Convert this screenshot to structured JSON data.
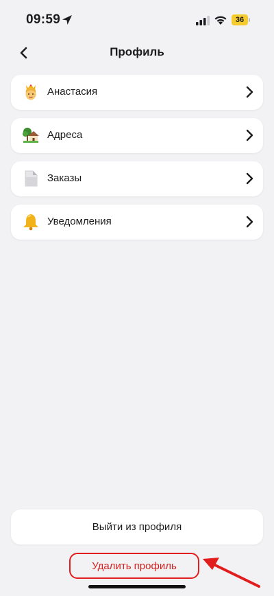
{
  "status_bar": {
    "time": "09:59",
    "battery_level": "36",
    "battery_color": "#f5cc2e"
  },
  "nav": {
    "title": "Профиль",
    "back_icon": "chevron-left-icon"
  },
  "menu": {
    "items": [
      {
        "label": "Анастасия",
        "icon": "princess-emoji-icon"
      },
      {
        "label": "Адреса",
        "icon": "house-with-garden-icon"
      },
      {
        "label": "Заказы",
        "icon": "document-icon"
      },
      {
        "label": "Уведомления",
        "icon": "bell-icon"
      }
    ]
  },
  "actions": {
    "logout_label": "Выйти из профиля",
    "delete_label": "Удалить профиль",
    "delete_color": "#d62020"
  },
  "annotation": {
    "color": "#e11d1d"
  }
}
